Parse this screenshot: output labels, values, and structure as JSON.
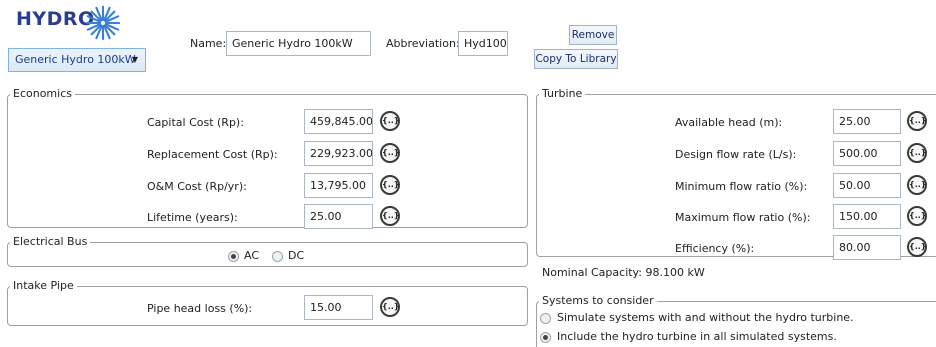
{
  "header": {
    "logo_text": "HYDRO",
    "component_select": "Generic Hydro 100kW",
    "name_label": "Name:",
    "name_value": "Generic Hydro 100kW",
    "abbrev_label": "Abbreviation:",
    "abbrev_value": "Hyd100",
    "remove_label": "Remove",
    "copy_label": "Copy To Library"
  },
  "economics": {
    "title": "Economics",
    "capital_label": "Capital Cost (Rp):",
    "capital_value": "459,845.00",
    "replacement_label": "Replacement Cost (Rp):",
    "replacement_value": "229,923.00",
    "om_label": "O&M Cost (Rp/yr):",
    "om_value": "13,795.00",
    "lifetime_label": "Lifetime (years):",
    "lifetime_value": "25.00"
  },
  "electrical_bus": {
    "title": "Electrical Bus",
    "ac_label": "AC",
    "dc_label": "DC",
    "selected": "AC"
  },
  "intake_pipe": {
    "title": "Intake Pipe",
    "headloss_label": "Pipe head loss (%):",
    "headloss_value": "15.00"
  },
  "turbine": {
    "title": "Turbine",
    "head_label": "Available head (m):",
    "head_value": "25.00",
    "flow_label": "Design flow rate (L/s):",
    "flow_value": "500.00",
    "min_label": "Minimum flow ratio (%):",
    "min_value": "50.00",
    "max_label": "Maximum flow ratio (%):",
    "max_value": "150.00",
    "eff_label": "Efficiency (%):",
    "eff_value": "80.00",
    "nominal_capacity": "Nominal Capacity: 98.100 kW"
  },
  "systems": {
    "title": "Systems to consider",
    "option1": "Simulate systems with and without the hydro turbine.",
    "option2": "Include the hydro turbine in all simulated systems.",
    "selected": "option2"
  },
  "icons": {
    "sensitivity": "sensitivity-icon",
    "logo": "hydro-turbine-logo-icon"
  },
  "colors": {
    "brand": "#2a3d8f",
    "logo_icon": "#3a7fd4",
    "group_border": "#a0a0a0",
    "input_border": "#a9b7c6"
  }
}
